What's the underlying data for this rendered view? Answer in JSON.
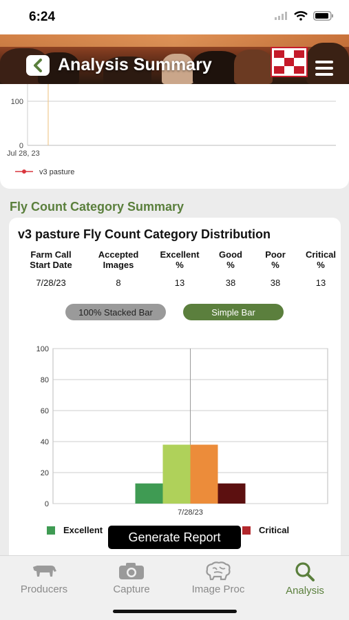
{
  "status_bar": {
    "time": "6:24"
  },
  "header": {
    "title": "Analysis Summary"
  },
  "top_chart": {
    "y_ticks": [
      "100",
      "0"
    ],
    "x_label": "Jul 28, 23",
    "legend": "v3 pasture",
    "line_color": "#d9363e"
  },
  "section": {
    "title": "Fly Count Category Summary"
  },
  "distribution": {
    "title": "v3 pasture Fly Count Category Distribution",
    "columns": [
      "Farm Call\nStart Date",
      "Accepted\nImages",
      "Excellent\n%",
      "Good\n%",
      "Poor\n%",
      "Critical\n%"
    ],
    "row": [
      "7/28/23",
      "8",
      "13",
      "38",
      "38",
      "13"
    ],
    "buttons": {
      "stacked": "100% Stacked Bar",
      "simple": "Simple Bar"
    }
  },
  "chart_data": {
    "type": "bar",
    "categories": [
      "7/28/23"
    ],
    "series": [
      {
        "name": "Excellent",
        "values": [
          13
        ],
        "color": "#3f9b53"
      },
      {
        "name": "Good",
        "values": [
          38
        ],
        "color": "#afd15a"
      },
      {
        "name": "Poor",
        "values": [
          38
        ],
        "color": "#ec8c3a"
      },
      {
        "name": "Critical",
        "values": [
          13
        ],
        "color": "#5c1010"
      }
    ],
    "ylim": [
      0,
      100
    ],
    "y_ticks": [
      "100",
      "80",
      "60",
      "40",
      "20",
      "0"
    ],
    "grid": true,
    "legend": "bottom"
  },
  "legend_visible": [
    {
      "name": "Excellent",
      "color": "#3f9b53"
    },
    {
      "name": "Critical",
      "color": "#b3282d"
    }
  ],
  "actions": {
    "generate_report": "Generate Report"
  },
  "tabs": [
    {
      "label": "Producers",
      "icon": "cow-icon"
    },
    {
      "label": "Capture",
      "icon": "camera-icon"
    },
    {
      "label": "Image Proc",
      "icon": "brain-icon"
    },
    {
      "label": "Analysis",
      "icon": "search-icon"
    }
  ]
}
